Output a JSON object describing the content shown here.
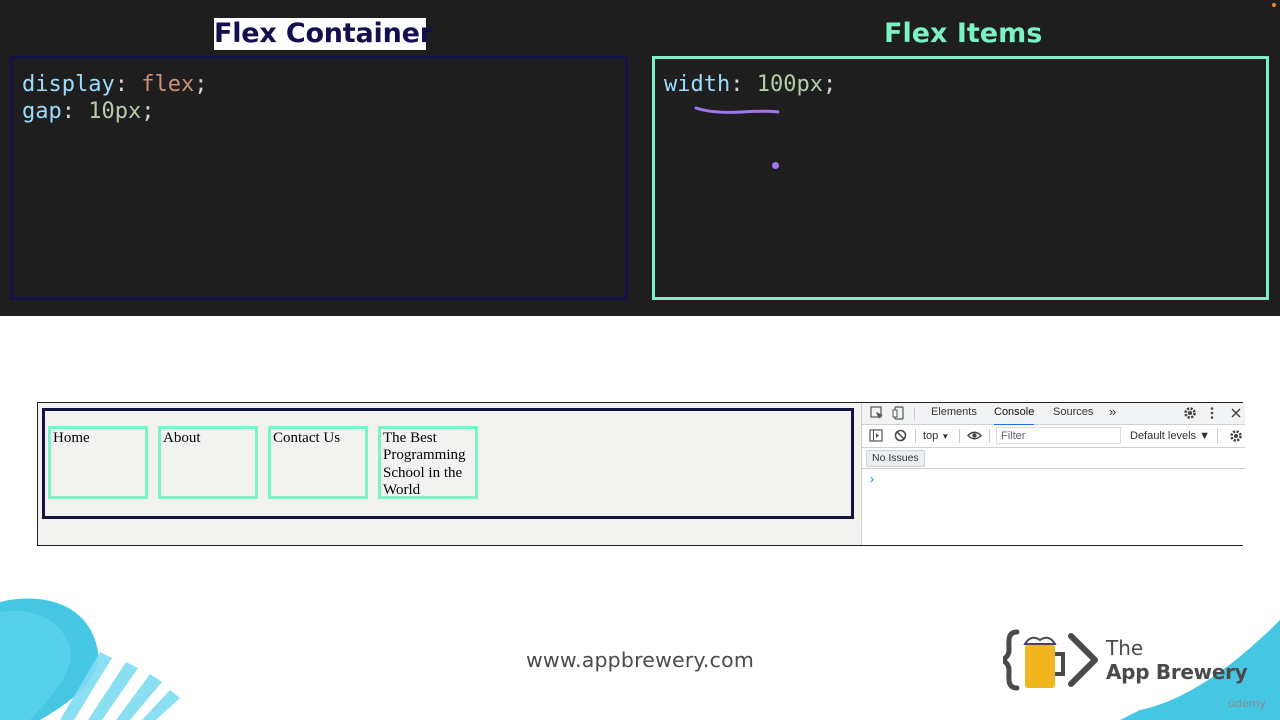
{
  "slide": {
    "left_title": "Flex Container",
    "right_title": "Flex Items",
    "left_code": [
      {
        "prop": "display",
        "value": "flex",
        "value_kind": "keyword"
      },
      {
        "prop": "gap",
        "value": "10px",
        "value_kind": "number"
      }
    ],
    "right_code": [
      {
        "prop": "width",
        "value": "100px",
        "value_kind": "number"
      }
    ]
  },
  "browser": {
    "nav_items": [
      "Home",
      "About",
      "Contact Us",
      "The Best Programming School in the World"
    ],
    "devtools": {
      "tabs": [
        "Elements",
        "Console",
        "Sources"
      ],
      "active_tab": "Console",
      "more_tabs_glyph": "»",
      "context": "top",
      "context_arrow": "▼",
      "filter_placeholder": "Filter",
      "levels": "Default levels ▼",
      "issues": "No Issues",
      "prompt": "›",
      "icons": [
        "inspect-icon",
        "device-toggle-icon",
        "settings-icon",
        "kebab-menu-icon",
        "close-icon",
        "sidebar-toggle-icon",
        "clear-console-icon",
        "eye-icon",
        "console-settings-icon"
      ]
    }
  },
  "footer": {
    "url": "www.appbrewery.com",
    "logo_line1": "The",
    "logo_line2": "App Brewery",
    "udemy": "ūdemy"
  },
  "colors": {
    "slide_bg": "#1e1e1e",
    "container_border": "#15124a",
    "item_border": "#7df0c8",
    "annotation": "#9f75f0"
  }
}
